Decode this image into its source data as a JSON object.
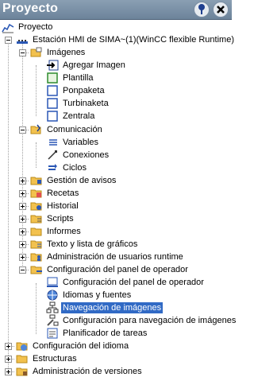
{
  "panel": {
    "title": "Proyecto",
    "pin_icon": "pin-icon",
    "close_icon": "close-icon"
  },
  "tree": {
    "root": "Proyecto",
    "device": "Estación HMI de SIMA~(1)(WinCC flexible Runtime)",
    "imagenes": {
      "label": "Imágenes",
      "children": [
        "Agregar Imagen",
        "Plantilla",
        "Ponpaketa",
        "Turbinaketa",
        "Zentrala"
      ]
    },
    "comunicacion": {
      "label": "Comunicación",
      "children": [
        "Variables",
        "Conexiones",
        "Ciclos"
      ]
    },
    "folders": [
      "Gestión de avisos",
      "Recetas",
      "Historial",
      "Scripts",
      "Informes",
      "Texto y lista de gráficos",
      "Administración de usuarios runtime"
    ],
    "config_panel": {
      "label": "Configuración del panel de operador",
      "children": [
        "Configuración del panel de operador",
        "Idiomas y fuentes",
        "Navegación de imágenes",
        "Configuración para navegación de imágenes",
        "Planificador de tareas"
      ],
      "selected": "Navegación de imágenes"
    },
    "bottom": [
      "Configuración del idioma",
      "Estructuras",
      "Administración de versiones"
    ]
  },
  "colors": {
    "title_bar": "#7990a6",
    "selection": "#316ac5",
    "folder": "#f2c14e"
  }
}
